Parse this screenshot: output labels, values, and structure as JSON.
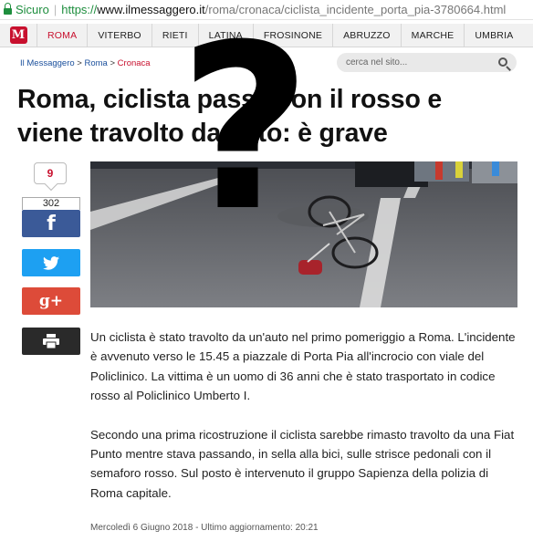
{
  "browser": {
    "secure_label": "Sicuro",
    "url_scheme": "https://",
    "url_host": "www.ilmessaggero.it",
    "url_path": "/roma/cronaca/ciclista_incidente_porta_pia-3780664.html"
  },
  "nav": {
    "logo_glyph": "M",
    "items": [
      "ROMA",
      "VITERBO",
      "RIETI",
      "LATINA",
      "FROSINONE",
      "ABRUZZO",
      "MARCHE",
      "UMBRIA"
    ],
    "active_color": "#c8102e"
  },
  "breadcrumb": {
    "home": "Il Messaggero",
    "sep1": " > ",
    "section": "Roma",
    "sep2": " > ",
    "current": "Cronaca"
  },
  "search": {
    "placeholder": "cerca nel sito..."
  },
  "article": {
    "headline": "Roma, ciclista passa con il rosso e viene travolto da auto: è grave",
    "comment_count": "9",
    "share_count": "302",
    "paragraphs": [
      "Un ciclista è stato travolto da un'auto nel primo pomeriggio a Roma. L'incidente è avvenuto verso le 15.45 a piazzale di Porta Pia all'incrocio con viale del Policlinico. La vittima è un uomo di 36 anni che è stato trasportato in codice rosso al Policlinico Umberto I.",
      "Secondo una prima ricostruzione il ciclista sarebbe rimasto travolto da una Fiat Punto mentre stava passando, in sella alla bici, sulle strisce pedonali con il semaforo rosso. Sul posto è intervenuto il gruppo Sapienza della polizia di Roma capitale."
    ],
    "dateline": "Mercoledì 6 Giugno 2018 - Ultimo aggiornamento: 20:21"
  },
  "social": {
    "facebook_glyph": "f",
    "googleplus_glyph": "g+",
    "icons": [
      "facebook-icon",
      "twitter-icon",
      "google-plus-icon",
      "print-icon"
    ]
  },
  "overlay": {
    "glyph": "?"
  }
}
